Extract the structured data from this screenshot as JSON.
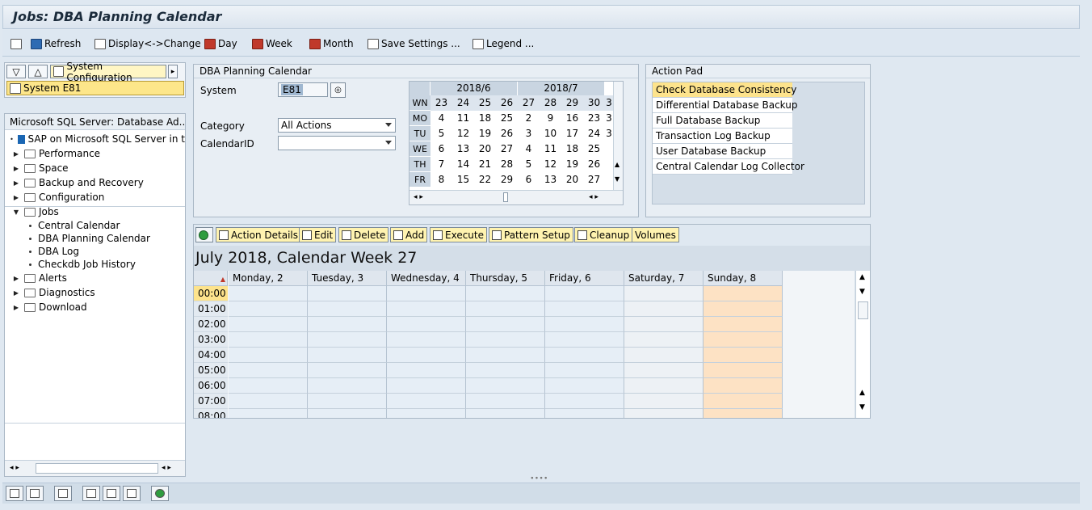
{
  "window": {
    "title": "Jobs: DBA Planning Calendar"
  },
  "toolbar": {
    "refresh": "Refresh",
    "display_change": "Display<->Change",
    "day": "Day",
    "week": "Week",
    "month": "Month",
    "save_settings": "Save Settings ...",
    "legend": "Legend ..."
  },
  "left_top": {
    "system_config": "System Configuration",
    "system": "System E81"
  },
  "tree": {
    "header": "Microsoft SQL Server: Database Ad...",
    "items": [
      {
        "label": "SAP on Microsoft SQL Server in t",
        "type": "sap"
      },
      {
        "label": "Performance",
        "type": "folder"
      },
      {
        "label": "Space",
        "type": "folder"
      },
      {
        "label": "Backup and Recovery",
        "type": "folder"
      },
      {
        "label": "Configuration",
        "type": "folder"
      },
      {
        "label": "Jobs",
        "type": "folder-open"
      },
      {
        "label": "Central Calendar",
        "type": "leaf"
      },
      {
        "label": "DBA Planning Calendar",
        "type": "leaf"
      },
      {
        "label": "DBA Log",
        "type": "leaf"
      },
      {
        "label": "Checkdb Job History",
        "type": "leaf"
      },
      {
        "label": "Alerts",
        "type": "folder"
      },
      {
        "label": "Diagnostics",
        "type": "folder"
      },
      {
        "label": "Download",
        "type": "folder"
      }
    ]
  },
  "dba_panel": {
    "title": "DBA Planning Calendar",
    "system_label": "System",
    "system_value": "E81",
    "category_label": "Category",
    "category_value": "All Actions",
    "calendar_id_label": "CalendarID",
    "calendar_id_value": ""
  },
  "mini_calendar": {
    "months": [
      "2018/6",
      "2018/7"
    ],
    "wn_label": "WN",
    "week_numbers": [
      "23",
      "24",
      "25",
      "26",
      "27",
      "28",
      "29",
      "30",
      "3"
    ],
    "weekdays": [
      "MO",
      "TU",
      "WE",
      "TH",
      "FR"
    ],
    "rows": [
      [
        "4",
        "11",
        "18",
        "25",
        "2",
        "9",
        "16",
        "23",
        "3"
      ],
      [
        "5",
        "12",
        "19",
        "26",
        "3",
        "10",
        "17",
        "24",
        "3"
      ],
      [
        "6",
        "13",
        "20",
        "27",
        "4",
        "11",
        "18",
        "25",
        ""
      ],
      [
        "7",
        "14",
        "21",
        "28",
        "5",
        "12",
        "19",
        "26",
        ""
      ],
      [
        "8",
        "15",
        "22",
        "29",
        "6",
        "13",
        "20",
        "27",
        ""
      ]
    ]
  },
  "action_pad": {
    "title": "Action Pad",
    "items": [
      "Check Database Consistency",
      "Differential Database Backup",
      "Full Database Backup",
      "Transaction Log Backup",
      "User Database Backup",
      "Central Calendar Log Collector"
    ]
  },
  "week_toolbar": {
    "action_details": "Action Details",
    "edit": "Edit",
    "delete": "Delete",
    "add": "Add",
    "execute": "Execute",
    "pattern_setup": "Pattern Setup",
    "cleanup": "Cleanup",
    "volumes": "Volumes"
  },
  "week_view": {
    "title": "July 2018, Calendar Week 27",
    "days": [
      "Monday, 2",
      "Tuesday, 3",
      "Wednesday, 4",
      "Thursday, 5",
      "Friday, 6",
      "Saturday, 7",
      "Sunday, 8"
    ],
    "times": [
      "00:00",
      "01:00",
      "02:00",
      "03:00",
      "04:00",
      "05:00",
      "06:00",
      "07:00",
      "08:00"
    ]
  },
  "colors": {
    "selection": "#fde38c",
    "sunday": "#fde2c4",
    "panel": "#e8eef4"
  }
}
